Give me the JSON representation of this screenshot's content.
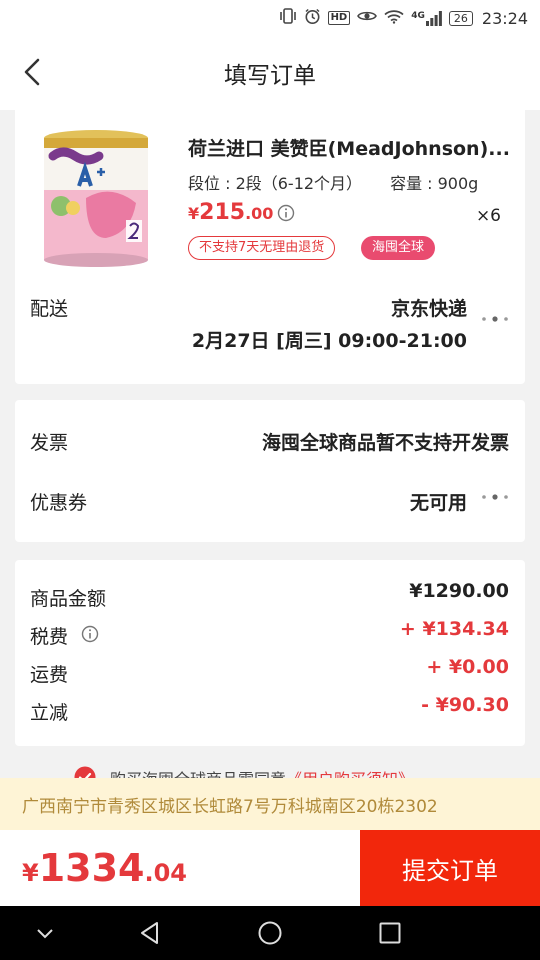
{
  "status_bar": {
    "hd": "HD",
    "network": "4G",
    "battery": "26",
    "time": "23:24"
  },
  "header": {
    "title": "填写订单"
  },
  "product": {
    "name": "荷兰进口 美赞臣(MeadJohnson)...",
    "stage_label": "段位 : 2段（6-12个月）",
    "capacity_label": "容量 : 900g",
    "price_currency": "¥",
    "price_int": "215",
    "price_dec": ".00",
    "quantity": "×6",
    "tag_return": "不支持7天无理由退货",
    "tag_global": "海囤全球"
  },
  "delivery": {
    "label": "配送",
    "carrier": "京东快递",
    "time": "2月27日 [周三] 09:00-21:00"
  },
  "invoice": {
    "label": "发票",
    "value": "海囤全球商品暂不支持开发票"
  },
  "coupon": {
    "label": "优惠券",
    "value": "无可用"
  },
  "summary": {
    "goods_label": "商品金额",
    "goods_value": "¥1290.00",
    "tax_label": "税费",
    "tax_value": "+ ¥134.34",
    "shipping_label": "运费",
    "shipping_value": "+ ¥0.00",
    "discount_label": "立减",
    "discount_value": "- ¥90.30"
  },
  "agreement": {
    "text": "购买海囤全球商品需同意",
    "link": "《用户购买须知》"
  },
  "address": {
    "text": "广西南宁市青秀区城区长虹路7号万科城南区20栋2302"
  },
  "footer": {
    "total_currency": "¥",
    "total_int": "1334",
    "total_dec": ".04",
    "submit_label": "提交订单"
  },
  "colors": {
    "accent_red": "#e4393c",
    "submit_red": "#f2270c",
    "tag_pink": "#e94b6f",
    "address_bg": "#fef4d6"
  }
}
